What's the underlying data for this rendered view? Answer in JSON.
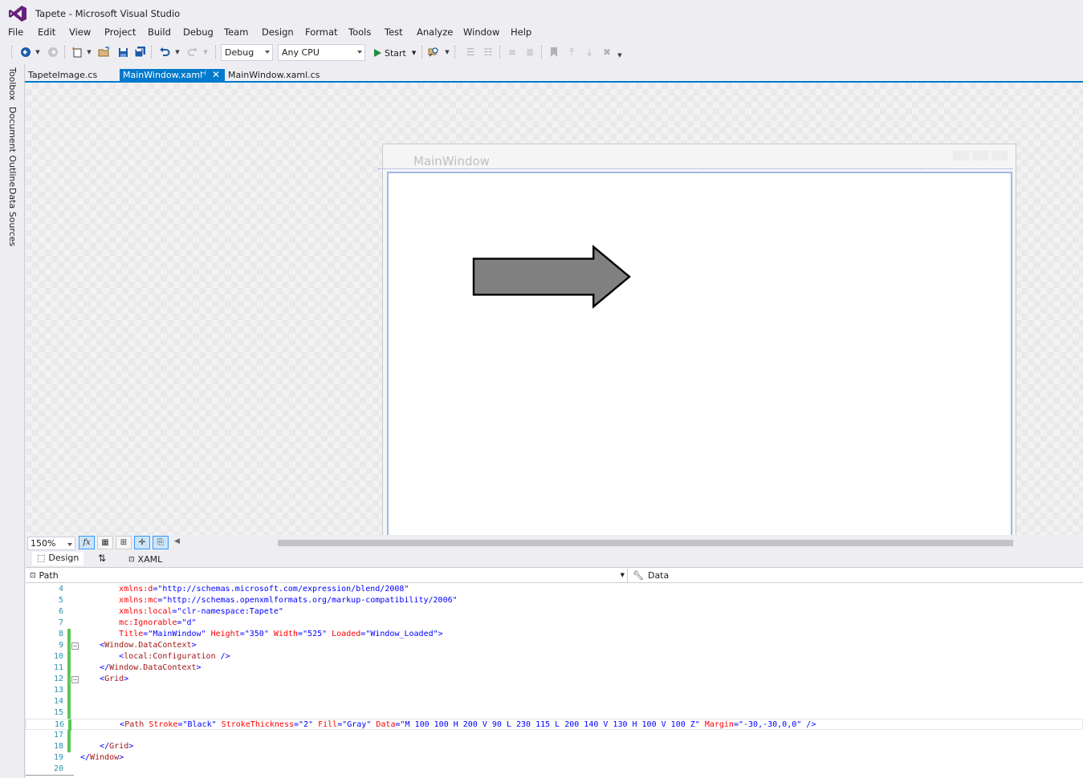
{
  "window": {
    "title": "Tapete - Microsoft Visual Studio"
  },
  "menu": [
    "File",
    "Edit",
    "View",
    "Project",
    "Build",
    "Debug",
    "Team",
    "Design",
    "Format",
    "Tools",
    "Test",
    "Analyze",
    "Window",
    "Help"
  ],
  "toolbar": {
    "config": "Debug",
    "platform": "Any CPU",
    "start_label": "Start"
  },
  "side_tabs": [
    "Toolbox",
    "Document Outline",
    "Data Sources"
  ],
  "doc_tabs": [
    "TapeteImage.cs",
    "MainWindow.xaml",
    "MainWindow.xaml.cs"
  ],
  "designer": {
    "window_title": "MainWindow",
    "shape_stroke": "#000000",
    "shape_fill": "#808080"
  },
  "zoom": "150%",
  "split_tabs": {
    "design": "Design",
    "xaml": "XAML"
  },
  "nav": {
    "element": "Path",
    "member": "Data"
  },
  "code_lines": [
    {
      "n": "4",
      "p": [
        [
          "i",
          "        "
        ],
        [
          "at",
          "xmlns:d"
        ],
        [
          "br",
          "="
        ],
        [
          "val",
          "\"http://schemas.microsoft.com/expression/blend/2008\""
        ]
      ]
    },
    {
      "n": "5",
      "p": [
        [
          "i",
          "        "
        ],
        [
          "at",
          "xmlns:mc"
        ],
        [
          "br",
          "="
        ],
        [
          "val",
          "\"http://schemas.openxmlformats.org/markup-compatibility/2006\""
        ]
      ]
    },
    {
      "n": "6",
      "p": [
        [
          "i",
          "        "
        ],
        [
          "at",
          "xmlns:local"
        ],
        [
          "br",
          "="
        ],
        [
          "val",
          "\"clr-namespace:Tapete\""
        ]
      ]
    },
    {
      "n": "7",
      "p": [
        [
          "i",
          "        "
        ],
        [
          "at",
          "mc:Ignorable"
        ],
        [
          "br",
          "="
        ],
        [
          "val",
          "\"d\""
        ]
      ]
    },
    {
      "n": "8",
      "p": [
        [
          "i",
          "        "
        ],
        [
          "at",
          "Title"
        ],
        [
          "br",
          "="
        ],
        [
          "val",
          "\"MainWindow\""
        ],
        [
          "i",
          " "
        ],
        [
          "at",
          "Height"
        ],
        [
          "br",
          "="
        ],
        [
          "val",
          "\"350\""
        ],
        [
          "i",
          " "
        ],
        [
          "at",
          "Width"
        ],
        [
          "br",
          "="
        ],
        [
          "val",
          "\"525\""
        ],
        [
          "i",
          " "
        ],
        [
          "at",
          "Loaded"
        ],
        [
          "br",
          "="
        ],
        [
          "val",
          "\"Window_Loaded\""
        ],
        [
          "br",
          ">"
        ]
      ]
    },
    {
      "n": "9",
      "p": [
        [
          "i",
          "    "
        ],
        [
          "br",
          "<"
        ],
        [
          "tag",
          "Window.DataContext"
        ],
        [
          "br",
          ">"
        ]
      ]
    },
    {
      "n": "10",
      "p": [
        [
          "i",
          "        "
        ],
        [
          "br",
          "<"
        ],
        [
          "tag",
          "local:Configuration"
        ],
        [
          "i",
          " "
        ],
        [
          "br",
          "/>"
        ]
      ]
    },
    {
      "n": "11",
      "p": [
        [
          "i",
          "    "
        ],
        [
          "br",
          "</"
        ],
        [
          "tag",
          "Window.DataContext"
        ],
        [
          "br",
          ">"
        ]
      ]
    },
    {
      "n": "12",
      "p": [
        [
          "i",
          "    "
        ],
        [
          "br",
          "<"
        ],
        [
          "tag",
          "Grid"
        ],
        [
          "br",
          ">"
        ]
      ]
    },
    {
      "n": "13",
      "p": []
    },
    {
      "n": "14",
      "p": []
    },
    {
      "n": "15",
      "p": []
    },
    {
      "n": "16",
      "p": [
        [
          "i",
          "        "
        ],
        [
          "br",
          "<"
        ],
        [
          "tag",
          "Path"
        ],
        [
          "i",
          " "
        ],
        [
          "at",
          "Stroke"
        ],
        [
          "br",
          "="
        ],
        [
          "val",
          "\"Black\""
        ],
        [
          "i",
          " "
        ],
        [
          "at",
          "StrokeThickness"
        ],
        [
          "br",
          "="
        ],
        [
          "val",
          "\"2\""
        ],
        [
          "i",
          " "
        ],
        [
          "at",
          "Fill"
        ],
        [
          "br",
          "="
        ],
        [
          "val",
          "\"Gray\""
        ],
        [
          "i",
          " "
        ],
        [
          "at",
          "Data"
        ],
        [
          "br",
          "="
        ],
        [
          "val",
          "\"M 100 100 H 200 V 90 L 230 115 L 200 140 V 130 H 100 V 100 Z\""
        ],
        [
          "i",
          " "
        ],
        [
          "at",
          "Margin"
        ],
        [
          "br",
          "="
        ],
        [
          "val",
          "\"-30,-30,0,0\""
        ],
        [
          "i",
          " "
        ],
        [
          "br",
          "/>"
        ]
      ]
    },
    {
      "n": "17",
      "p": []
    },
    {
      "n": "18",
      "p": [
        [
          "i",
          "    "
        ],
        [
          "br",
          "</"
        ],
        [
          "tag",
          "Grid"
        ],
        [
          "br",
          ">"
        ]
      ]
    },
    {
      "n": "19",
      "p": [
        [
          "br",
          "</"
        ],
        [
          "tag",
          "Window"
        ],
        [
          "br",
          ">"
        ]
      ]
    },
    {
      "n": "20",
      "p": []
    }
  ]
}
